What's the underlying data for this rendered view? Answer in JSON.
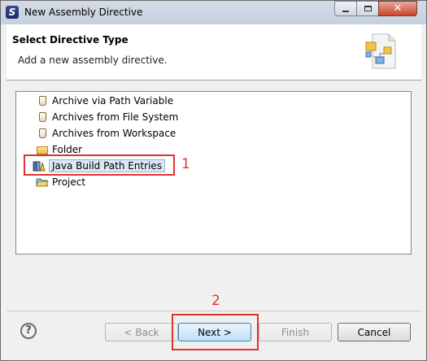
{
  "window": {
    "title": "New Assembly Directive",
    "app_icon_letter": "S"
  },
  "header": {
    "title": "Select Directive Type",
    "description": "Add a new assembly directive."
  },
  "list": {
    "items": [
      {
        "label": "Archive via Path Variable",
        "icon": "jar-icon"
      },
      {
        "label": "Archives from File System",
        "icon": "jar-icon"
      },
      {
        "label": "Archives from Workspace",
        "icon": "jar-icon"
      },
      {
        "label": "Folder",
        "icon": "folder-icon"
      },
      {
        "label": "Java Build Path Entries",
        "icon": "library-icon",
        "selected": true
      },
      {
        "label": "Project",
        "icon": "project-icon"
      }
    ]
  },
  "annotations": {
    "step1": "1",
    "step2": "2",
    "color": "#e0342f"
  },
  "buttons": {
    "help": "?",
    "back": "< Back",
    "next": "Next >",
    "finish": "Finish",
    "cancel": "Cancel"
  }
}
